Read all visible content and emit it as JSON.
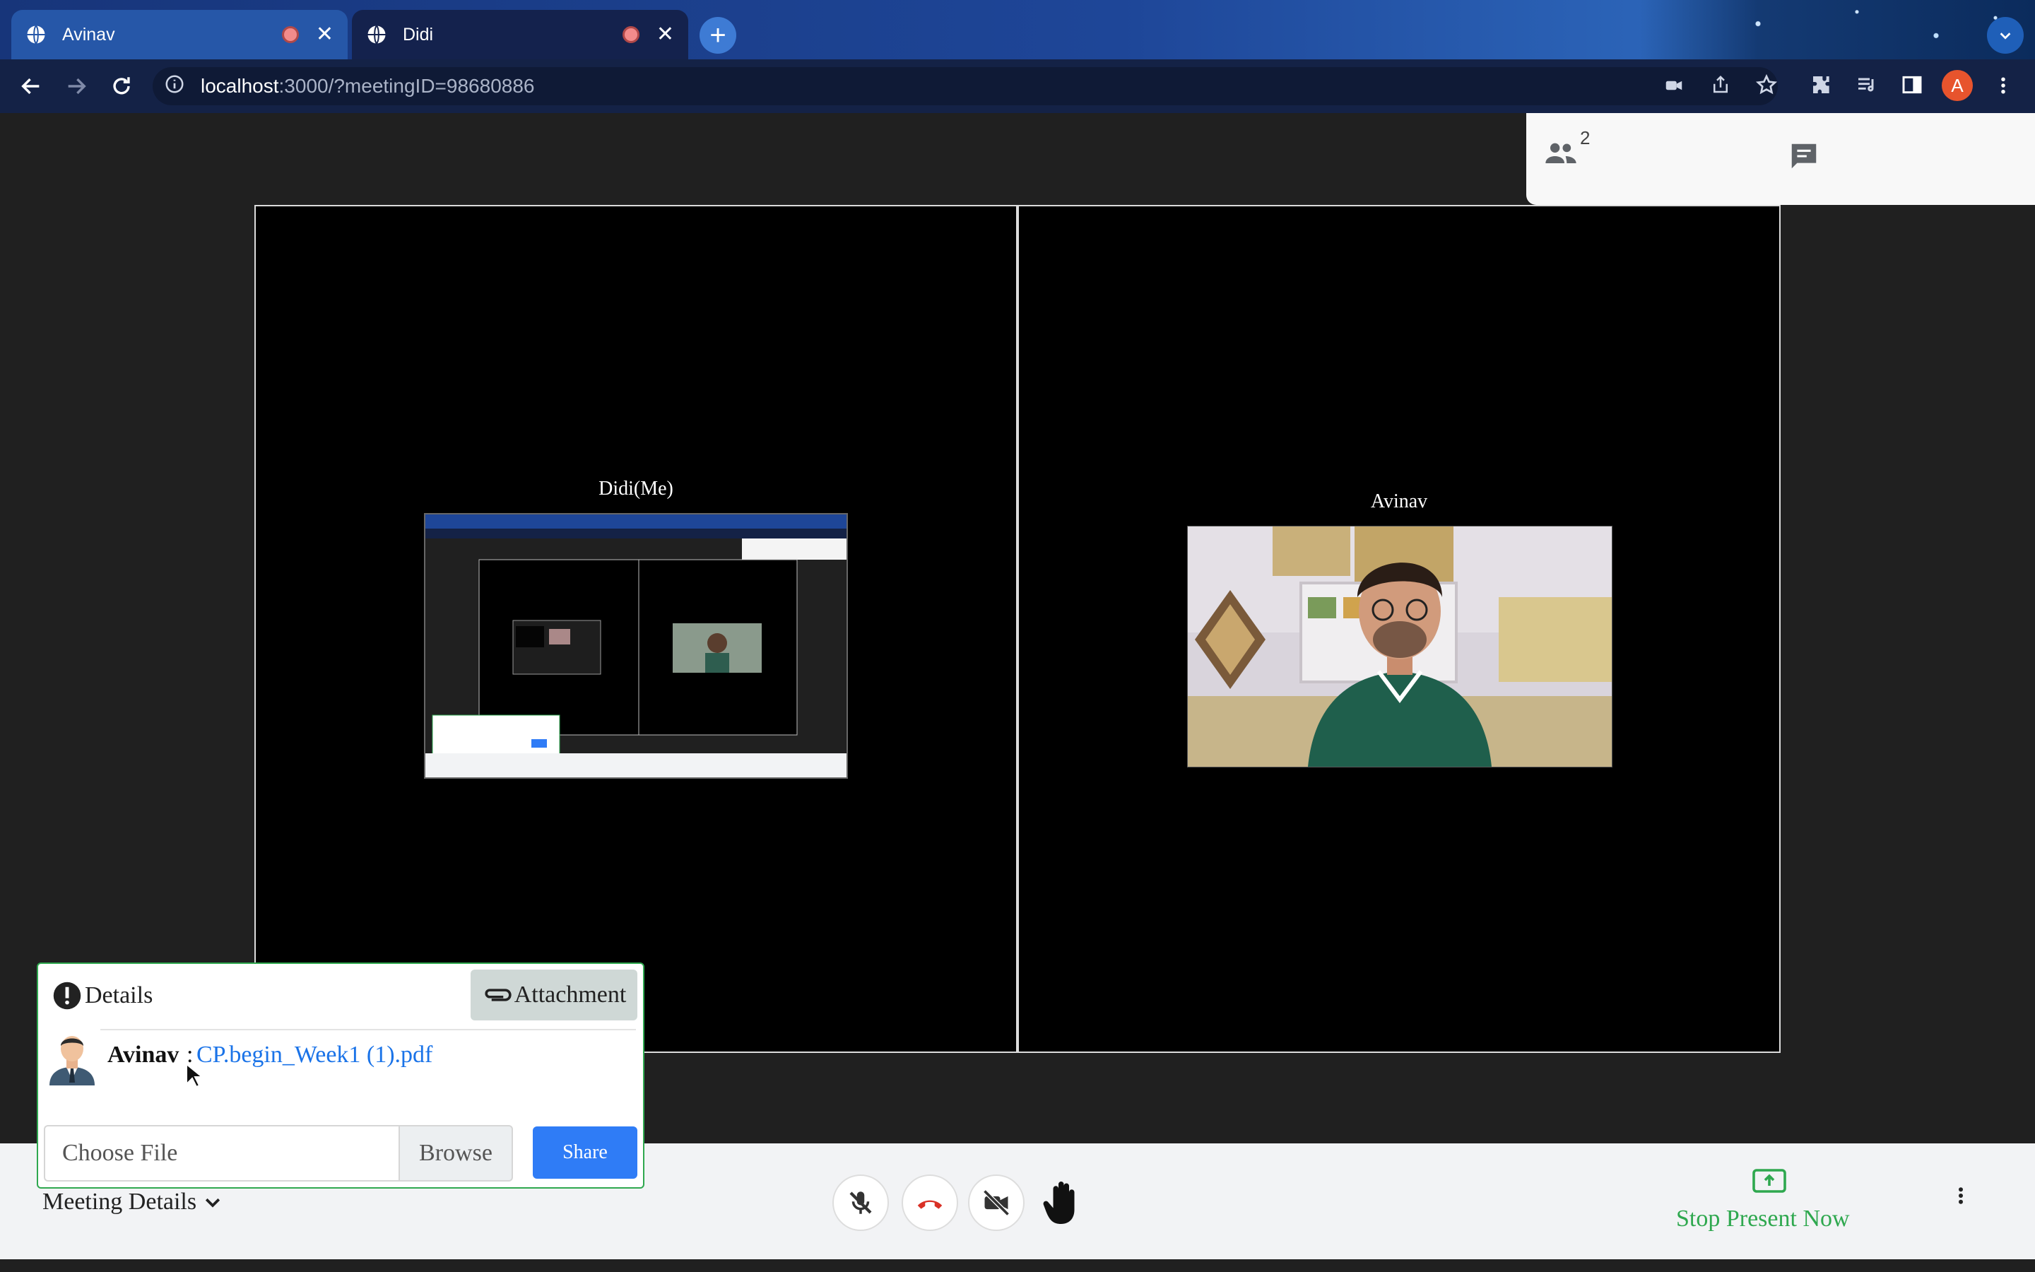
{
  "browser": {
    "tabs": [
      {
        "title": "Avinav",
        "active": false
      },
      {
        "title": "Didi",
        "active": true
      }
    ],
    "url_host": "localhost",
    "url_rest": ":3000/?meetingID=98680886",
    "profile_initial": "A"
  },
  "meeting": {
    "participant_count": "2",
    "tiles": [
      {
        "name": "Didi(Me)"
      },
      {
        "name": "Avinav"
      }
    ]
  },
  "details": {
    "title": "Details",
    "attachment_label": "Attachment",
    "message_sender": "Avinav",
    "message_separator": ":",
    "file_link": "CP.begin_Week1 (1).pdf",
    "file_placeholder": "Choose File",
    "browse_label": "Browse",
    "share_label": "Share"
  },
  "bottom": {
    "meeting_details_label": "Meeting Details",
    "stop_present_label": "Stop Present Now"
  },
  "colors": {
    "accent_green": "#2fa84f",
    "share_blue": "#2f7cf6",
    "link_blue": "#1a73e8",
    "end_call_red": "#d93025"
  },
  "icons": [
    "globe-icon",
    "record-icon",
    "close-icon",
    "plus-icon",
    "chevron-down-icon",
    "back-icon",
    "forward-icon",
    "reload-icon",
    "info-icon",
    "camera-off-icon",
    "share-page-icon",
    "star-icon",
    "extensions-icon",
    "media-icon",
    "sidebar-icon",
    "more-vert-icon",
    "people-icon",
    "chat-icon",
    "alert-icon",
    "paperclip-icon",
    "avatar-icon",
    "mic-off-icon",
    "end-call-icon",
    "video-off-icon",
    "raise-hand-icon",
    "present-icon"
  ]
}
